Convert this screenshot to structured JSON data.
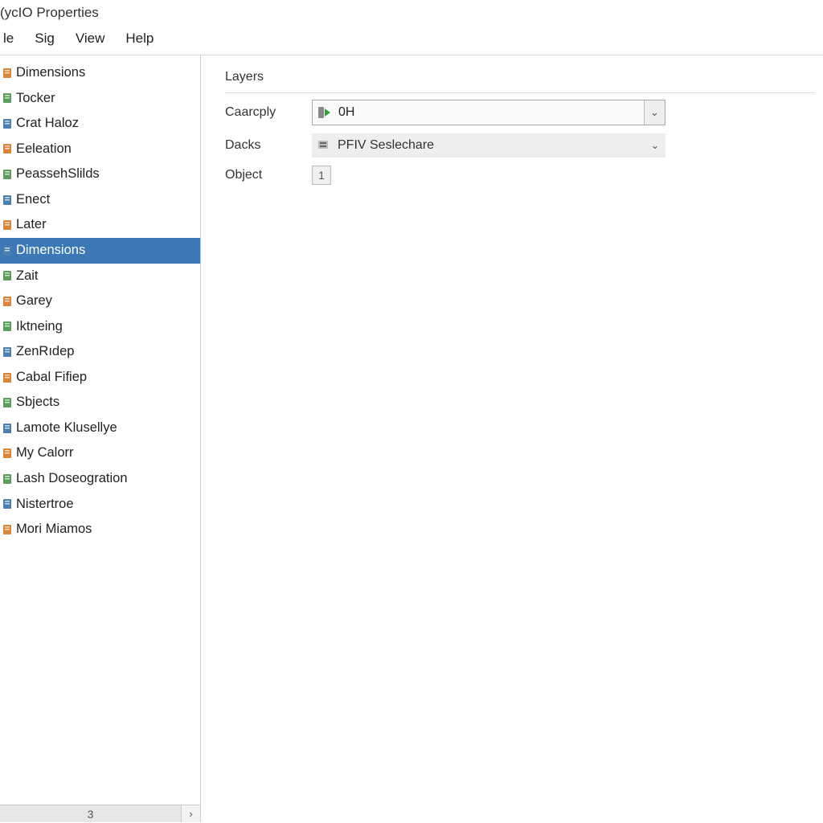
{
  "window": {
    "title": "(ycIO Properties"
  },
  "menu": {
    "items": [
      "le",
      "Sig",
      "View",
      "Help"
    ]
  },
  "sidebar": {
    "items": [
      {
        "label": "Dimensions",
        "icon": "doc-orange"
      },
      {
        "label": "Tocker",
        "icon": "doc-green"
      },
      {
        "label": "Crat Haloz",
        "icon": "doc-blue"
      },
      {
        "label": "Eeleation",
        "icon": "doc-orange"
      },
      {
        "label": "PeassehSlilds",
        "icon": "doc-green"
      },
      {
        "label": "Enect",
        "icon": "doc-blue"
      },
      {
        "label": "Later",
        "icon": "doc-orange"
      },
      {
        "label": "Dimensions",
        "icon": "doc-blue",
        "selected": true
      },
      {
        "label": "Zait",
        "icon": "doc-green"
      },
      {
        "label": "Garey",
        "icon": "doc-orange"
      },
      {
        "label": "Iktneing",
        "icon": "doc-green"
      },
      {
        "label": "ZenRıdep",
        "icon": "doc-blue"
      },
      {
        "label": "Cabal Fifiep",
        "icon": "doc-orange"
      },
      {
        "label": "Sbjects",
        "icon": "doc-green"
      },
      {
        "label": "Lamote Klusellye",
        "icon": "doc-blue"
      },
      {
        "label": "My Calorr",
        "icon": "doc-orange"
      },
      {
        "label": "Lash Doseogration",
        "icon": "doc-green"
      },
      {
        "label": "Nistertroe",
        "icon": "doc-blue"
      },
      {
        "label": "Mori Miamos",
        "icon": "doc-orange"
      }
    ],
    "status": "3"
  },
  "panel": {
    "group_label": "Layers",
    "rows": {
      "caarcply": {
        "label": "Caarcply",
        "value": "0H",
        "icon": "play-green"
      },
      "dacks": {
        "label": "Dacks",
        "value": "PFIV Seslechare",
        "icon": "gear"
      },
      "object": {
        "label": "Object",
        "value": "1"
      }
    }
  }
}
